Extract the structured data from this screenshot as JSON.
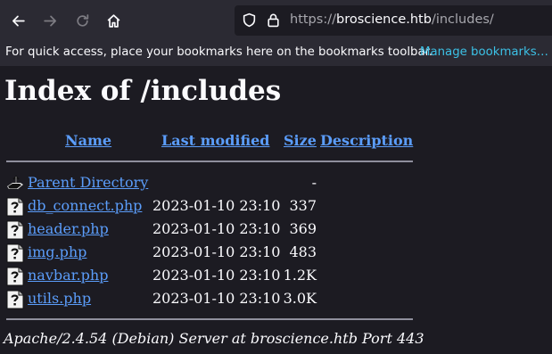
{
  "browser": {
    "url_prefix": "https://",
    "url_host": "broscience.htb",
    "url_path": "/includes/"
  },
  "bookmarks_bar": {
    "message": "For quick access, place your bookmarks here on the bookmarks toolbar.",
    "manage_link": "Manage bookmarks…"
  },
  "page": {
    "title": "Index of /includes",
    "columns": {
      "name": "Name",
      "last_modified": "Last modified",
      "size": "Size",
      "description": "Description"
    },
    "parent": {
      "name": "Parent Directory",
      "size": "-",
      "icon": "back-folder-icon"
    },
    "rows": [
      {
        "name": "db_connect.php",
        "modified": "2023-01-10 23:10",
        "size": "337",
        "icon": "unknown-file-icon"
      },
      {
        "name": "header.php",
        "modified": "2023-01-10 23:10",
        "size": "369",
        "icon": "unknown-file-icon"
      },
      {
        "name": "img.php",
        "modified": "2023-01-10 23:10",
        "size": "483",
        "icon": "unknown-file-icon"
      },
      {
        "name": "navbar.php",
        "modified": "2023-01-10 23:10",
        "size": "1.2K",
        "icon": "unknown-file-icon"
      },
      {
        "name": "utils.php",
        "modified": "2023-01-10 23:10",
        "size": "3.0K",
        "icon": "unknown-file-icon"
      }
    ],
    "footer": "Apache/2.4.54 (Debian) Server at broscience.htb Port 443"
  }
}
